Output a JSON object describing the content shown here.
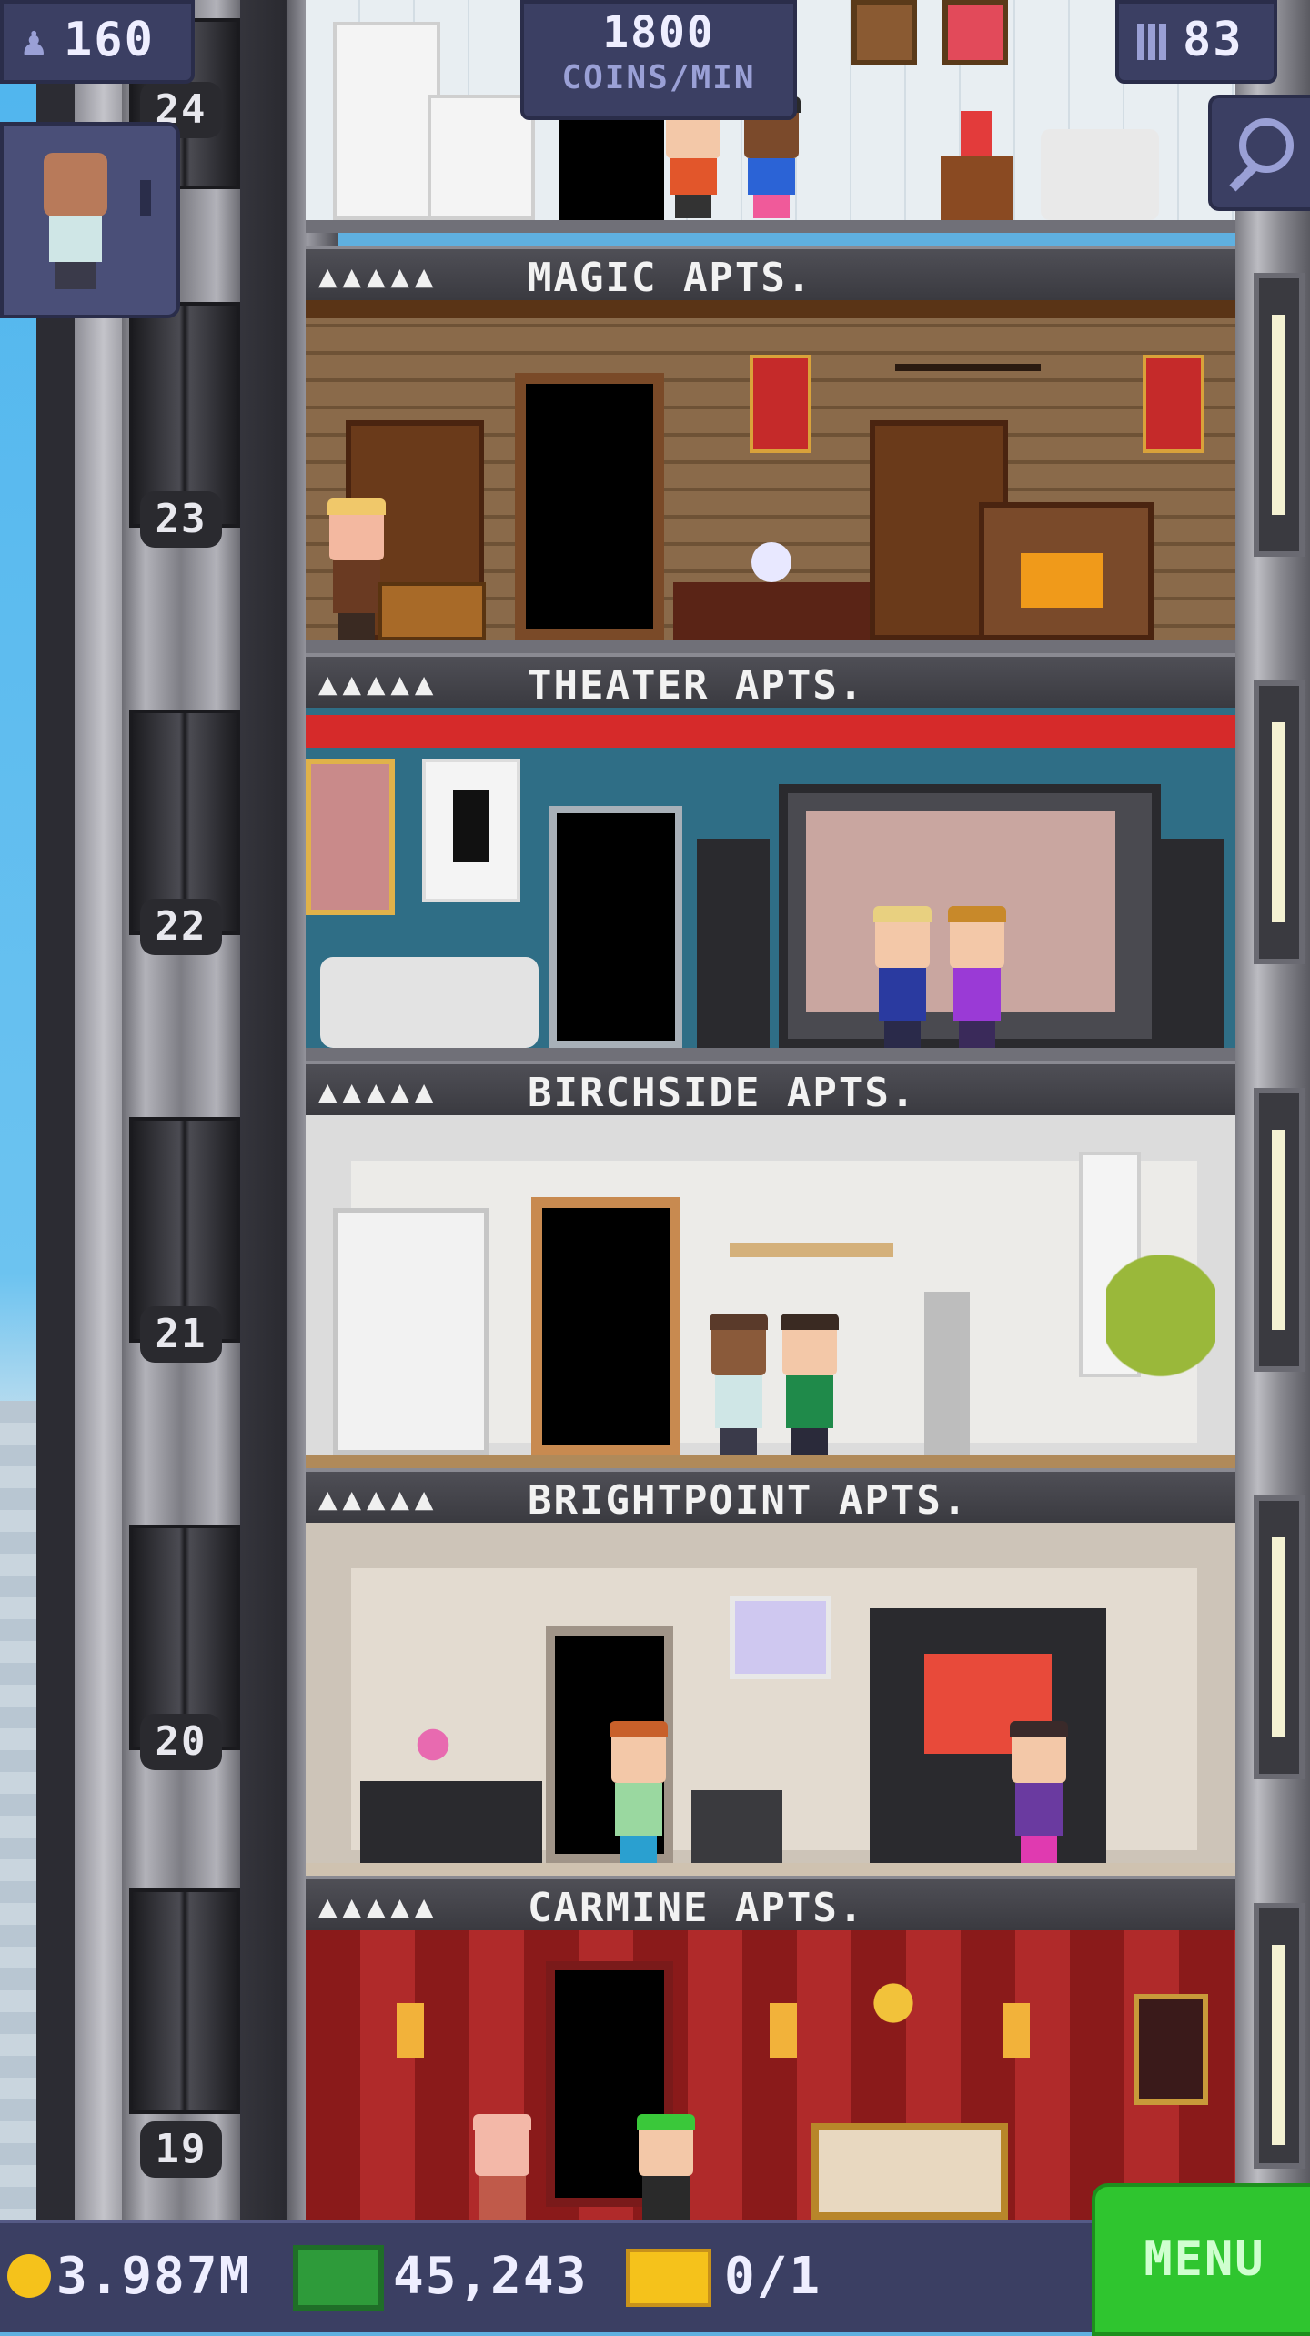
{
  "hud": {
    "population": "160",
    "coins_per_min_value": "1800",
    "coins_per_min_label": "COINS/MIN",
    "floor_count": "83"
  },
  "floors": [
    {
      "number": "24"
    },
    {
      "number": "23",
      "name": "MAGIC APTS.",
      "pips": "▲▲▲▲▲"
    },
    {
      "number": "22",
      "name": "THEATER APTS.",
      "pips": "▲▲▲▲▲"
    },
    {
      "number": "21",
      "name": "BIRCHSIDE APTS.",
      "pips": "▲▲▲▲▲"
    },
    {
      "number": "20",
      "name": "BRIGHTPOINT APTS.",
      "pips": "▲▲▲▲▲"
    },
    {
      "number": "19",
      "name": "CARMINE APTS.",
      "pips": "▲▲▲▲▲"
    }
  ],
  "bottom": {
    "coins": "3.987M",
    "bux": "45,243",
    "tickets": "0/1",
    "menu_label": "MENU"
  },
  "colors": {
    "hud_bg": "#3b3f63",
    "menu_green": "#2fc52f",
    "coin_gold": "#f5c21b",
    "bux_green": "#2e9b3a"
  },
  "icons": [
    "person-icon",
    "building-icon",
    "magnifier-icon",
    "coin-icon",
    "bux-icon",
    "ticket-icon"
  ]
}
